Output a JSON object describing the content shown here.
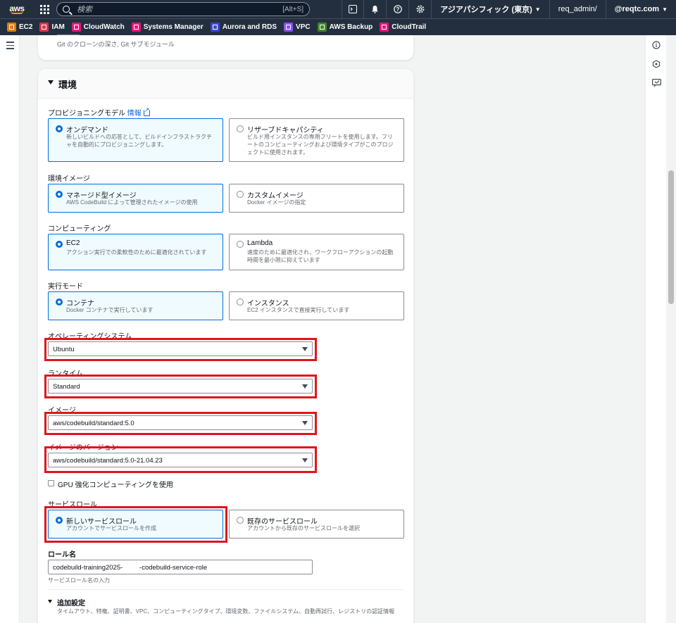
{
  "topnav": {
    "logo": "aws",
    "search_placeholder": "検索",
    "search_shortcut": "[Alt+S]",
    "region": "アジアパシフィック (東京)",
    "account": "req_admin/",
    "user": "@reqtc.com"
  },
  "favorites": [
    {
      "label": "EC2",
      "color": "#e07a16",
      "icon": "ec2-icon"
    },
    {
      "label": "IAM",
      "color": "#dd344c",
      "icon": "iam-icon"
    },
    {
      "label": "CloudWatch",
      "color": "#e7157b",
      "icon": "cloudwatch-icon"
    },
    {
      "label": "Systems Manager",
      "color": "#e7157b",
      "icon": "systems-manager-icon"
    },
    {
      "label": "Aurora and RDS",
      "color": "#3b48cc",
      "icon": "rds-icon"
    },
    {
      "label": "VPC",
      "color": "#8c4fff",
      "icon": "vpc-icon"
    },
    {
      "label": "AWS Backup",
      "color": "#3f8624",
      "icon": "backup-icon"
    },
    {
      "label": "CloudTrail",
      "color": "#e7157b",
      "icon": "cloudtrail-icon"
    }
  ],
  "prev_section": {
    "title_fragment": "─────",
    "desc": "Git のクローンの深さ, Git サブモジュール"
  },
  "section": {
    "title": "環境"
  },
  "provisioning": {
    "label": "プロビジョニングモデル",
    "info": "情報",
    "options": [
      {
        "title": "オンデマンド",
        "desc": "新しいビルドへの応答として、ビルドインフラストラクチャを自動的にプロビジョニングします。",
        "selected": true
      },
      {
        "title": "リザーブドキャパシティ",
        "desc": "ビルド用インスタンスの専用フリートを使用します。フリートのコンピューティングおよび環境タイプがこのプロジェクトに使用されます。",
        "selected": false
      }
    ]
  },
  "env_image": {
    "label": "環境イメージ",
    "options": [
      {
        "title": "マネージド型イメージ",
        "desc": "AWS CodeBuild によって管理されたイメージの使用",
        "selected": true
      },
      {
        "title": "カスタムイメージ",
        "desc": "Docker イメージの指定",
        "selected": false
      }
    ]
  },
  "compute": {
    "label": "コンピューティング",
    "options": [
      {
        "title": "EC2",
        "desc": "アクション実行での柔軟性のために最適化されています",
        "selected": true
      },
      {
        "title": "Lambda",
        "desc": "速度のために最適化され、ワークフローアクションの起動時間を最小限に抑えています",
        "selected": false
      }
    ]
  },
  "run_mode": {
    "label": "実行モード",
    "options": [
      {
        "title": "コンテナ",
        "desc": "Docker コンテナで実行しています",
        "selected": true
      },
      {
        "title": "インスタンス",
        "desc": "EC2 インスタンスで直接実行しています",
        "selected": false
      }
    ]
  },
  "os": {
    "label": "オペレーティングシステム",
    "value": "Ubuntu"
  },
  "runtime": {
    "label": "ランタイム",
    "value": "Standard"
  },
  "image": {
    "label": "イメージ",
    "value": "aws/codebuild/standard:5.0"
  },
  "image_version": {
    "label": "イメージのバージョン",
    "value": "aws/codebuild/standard:5.0-21.04.23"
  },
  "gpu": {
    "label": "GPU 強化コンピューティングを使用",
    "checked": false
  },
  "service_role": {
    "label": "サービスロール",
    "options": [
      {
        "title": "新しいサービスロール",
        "desc": "アカウントでサービスロールを作成",
        "selected": true
      },
      {
        "title": "既存のサービスロール",
        "desc": "アカウントから既存のサービスロールを選択",
        "selected": false
      }
    ]
  },
  "role_name": {
    "label": "ロール名",
    "value": "codebuild-training2025-         -codebuild-service-role",
    "hint": "サービスロール名の入力"
  },
  "additional": {
    "title": "追加設定",
    "desc": "タイムアウト、特権、証明書、VPC、コンピューティングタイプ、環境変数、ファイルシステム、自動再試行、レジストリの認証情報"
  },
  "colors": {
    "nav_bg": "#232f3e",
    "accent": "#006ce0",
    "selected_bg": "#f0fbff",
    "highlight": "#e0151b"
  }
}
